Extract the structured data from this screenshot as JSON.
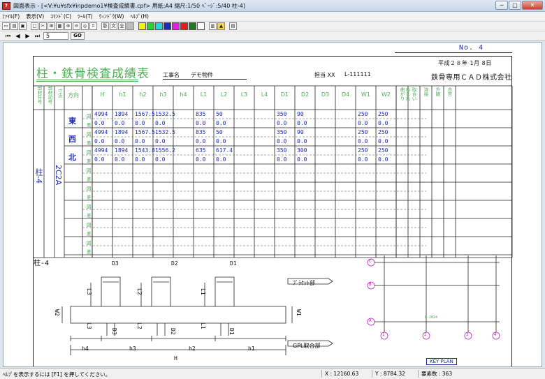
{
  "window": {
    "title": "図面表示 - [<V:¥u¥sfx¥inpdemo1¥検査成績書.cpf>  用紙:A4 縮尺:1/50 ﾍﾟｰｼﾞ:5/40 柱-4]",
    "minimize": "─",
    "maximize": "□",
    "close": "✕"
  },
  "menu": [
    "ﾌｧｲﾙ(F)",
    "表示(V)",
    "ｺﾏﾝﾄﾞ(C)",
    "ﾂｰﾙ(T)",
    "ｳｨﾝﾄﾞｳ(W)",
    "ﾍﾙﾌﾟ(H)"
  ],
  "toolbar": {
    "shadow": "影",
    "text": "文",
    "all": "全"
  },
  "colors": {
    "blue": "#1d2bb5",
    "green": "#4caf55",
    "magenta": "#c21fbd"
  },
  "swatches": [
    "#f5f500",
    "#28d428",
    "#24d8d8",
    "#1d2bb5",
    "#e01fe0",
    "#e01f1f",
    "#1f7a1f",
    "#ffffff"
  ],
  "nav": {
    "page": "5",
    "go": "GO"
  },
  "doc": {
    "page_no": "No. 4",
    "title": "柱・鉄骨検査成績表",
    "project_label": "工事名",
    "project_name": "デモ物件",
    "staff_label": "担当 XX",
    "staff_code": "L-111111",
    "date": "平成２８年  1月  8日",
    "company": "鉄骨専用ＣＡＤ株式会社"
  },
  "table": {
    "side_headers": [
      "部材符号",
      "部材記号",
      "寸法"
    ],
    "direction_header": "方向",
    "columns": [
      "H",
      "h1",
      "h2",
      "h3",
      "h4",
      "L1",
      "L2",
      "L3",
      "L4",
      "D1",
      "D2",
      "D3",
      "D4",
      "W1",
      "W2"
    ],
    "extra_headers": [
      "ねじれ・曲がり",
      "取合い",
      "溶接",
      "外観",
      "合否"
    ],
    "row_type_labels": [
      "図",
      "差"
    ],
    "member_code": "柱-4",
    "member_mark": "2C2A",
    "directions": [
      "東",
      "西",
      "北"
    ],
    "rows": [
      [
        "4994",
        "1894",
        "1567.5",
        "1532.5",
        "",
        "835",
        "50",
        "",
        "",
        "350",
        "90",
        "",
        "",
        "250",
        "250"
      ],
      [
        "0.0",
        "0.0",
        "0.0",
        "0.0",
        "",
        "0.0",
        "0.0",
        "",
        "",
        "0.0",
        "0.0",
        "",
        "",
        "0.0",
        "0.0"
      ],
      [
        "4994",
        "1894",
        "1567.5",
        "1532.5",
        "",
        "835",
        "50",
        "",
        "",
        "350",
        "90",
        "",
        "",
        "250",
        "250"
      ],
      [
        "0.0",
        "0.0",
        "0.0",
        "0.0",
        "",
        "0.0",
        "0.0",
        "",
        "",
        "0.0",
        "0.0",
        "",
        "",
        "0.0",
        "0.0"
      ],
      [
        "4994",
        "1894",
        "1543.8",
        "1556.2",
        "",
        "635",
        "617.4",
        "",
        "",
        "350",
        "300",
        "",
        "",
        "250",
        "250"
      ],
      [
        "0.0",
        "0.0",
        "0.0",
        "0.0",
        "",
        "0.0",
        "0.0",
        "",
        "",
        "0.0",
        "0.0",
        "",
        "",
        "0.0",
        "0.0"
      ]
    ]
  },
  "drawing": {
    "label": "柱-4",
    "dims_top": [
      "D3",
      "D2",
      "D1"
    ],
    "dims_L": [
      "L3",
      "L2",
      "L1"
    ],
    "dims_L_low": [
      "L3",
      "L2",
      "L1"
    ],
    "dims_D_low": [
      "D3",
      "D2",
      "D1"
    ],
    "dims_h": [
      "h4",
      "h3",
      "h2",
      "h1"
    ],
    "dim_H": "H",
    "dim_w2": "W2",
    "dim_w1": "W1",
    "bracket_label": "ﾌﾞﾗｹｯﾄ部",
    "gpl_label": "GPL取合部"
  },
  "keyplan": {
    "label": "KEY PLAN",
    "rows": [
      "C",
      "B",
      "A"
    ],
    "cols": [
      "1",
      "2",
      "3",
      "4"
    ],
    "marker": "L-2024"
  },
  "status": {
    "help": "ﾍﾙﾌﾟを表示するには [F1] を押してください。",
    "x": "X : 12160.63",
    "y": "Y : 8784.32",
    "count": "要素数 : 363"
  }
}
